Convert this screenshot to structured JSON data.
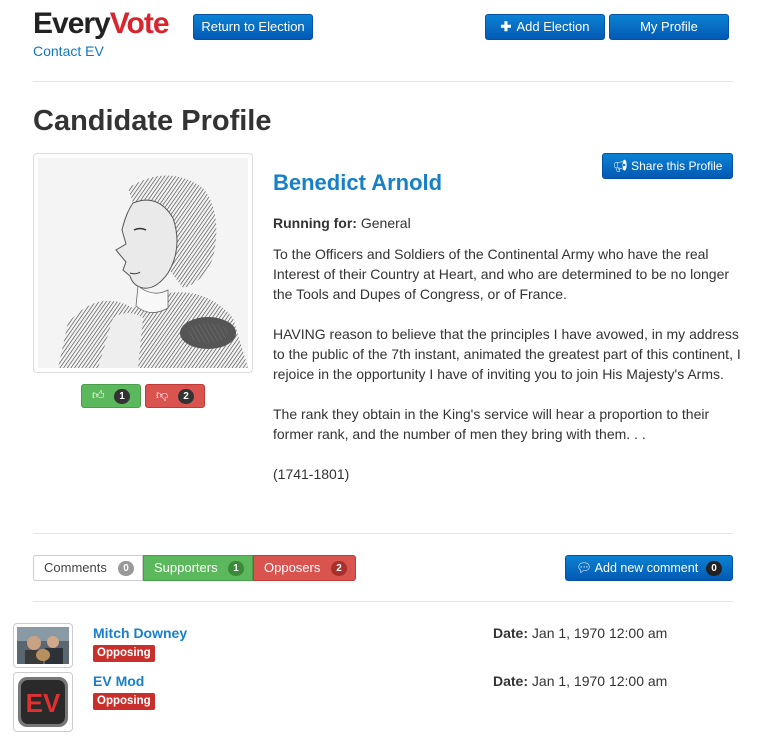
{
  "header": {
    "logo_every": "Every",
    "logo_vote": "Vote",
    "contact": "Contact EV",
    "return_label": "Return to Election",
    "add_label": "Add Election",
    "profile_label": "My Profile"
  },
  "page": {
    "title": "Candidate Profile"
  },
  "candidate": {
    "name": "Benedict Arnold",
    "running_label": "Running for:",
    "running_value": "General",
    "share_label": "Share this Profile",
    "up_count": "1",
    "down_count": "2",
    "bio": [
      "To the Officers and Soldiers of the Continental Army who have the real Interest of their Country at Heart, and who are determined to be no longer the Tools and Dupes of Congress, or of France.",
      "HAVING reason to believe that the principles I have avowed, in my address to the public of the 7th instant, animated the greatest part of this continent, I rejoice in the opportunity I have of inviting you to join His Majesty's Arms.",
      "The rank they obtain in the King's service will hear a proportion to their former rank, and the number of men they bring with them. . .",
      "(1741-1801)"
    ]
  },
  "tabs": {
    "comments_label": "Comments",
    "comments_count": "0",
    "supporters_label": "Supporters",
    "supporters_count": "1",
    "opposers_label": "Opposers",
    "opposers_count": "2",
    "new_comment_label": "Add new comment",
    "new_comment_count": "0"
  },
  "opposers": [
    {
      "name": "Mitch Downey",
      "badge": "Opposing",
      "date_label": "Date:",
      "date": "Jan 1, 1970 12:00 am"
    },
    {
      "name": "EV Mod",
      "badge": "Opposing",
      "date_label": "Date:",
      "date": "Jan 1, 1970 12:00 am",
      "avatar_text": "EV"
    }
  ]
}
